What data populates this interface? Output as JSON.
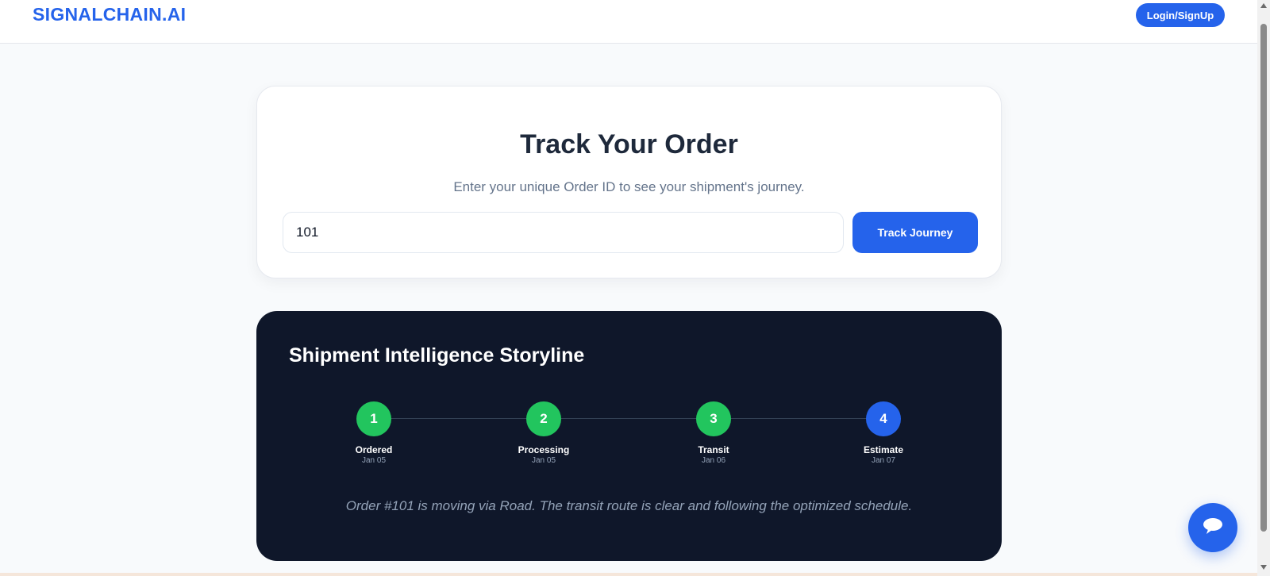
{
  "header": {
    "brand": "SIGNALCHAIN.AI",
    "login_label": "Login/SignUp"
  },
  "track": {
    "title": "Track Your Order",
    "subtitle": "Enter your unique Order ID to see your shipment's journey.",
    "order_id_value": "101",
    "button_label": "Track Journey"
  },
  "storyline": {
    "title": "Shipment Intelligence Storyline",
    "steps": [
      {
        "number": "1",
        "label": "Ordered",
        "date": "Jan 05",
        "status": "done"
      },
      {
        "number": "2",
        "label": "Processing",
        "date": "Jan 05",
        "status": "done"
      },
      {
        "number": "3",
        "label": "Transit",
        "date": "Jan 06",
        "status": "done"
      },
      {
        "number": "4",
        "label": "Estimate",
        "date": "Jan 07",
        "status": "current"
      }
    ],
    "message": "Order #101 is moving via Road. The transit route is clear and following the optimized schedule."
  },
  "chat": {
    "icon": "chat-bubble-icon"
  },
  "colors": {
    "accent": "#2563eb",
    "done": "#22c55e",
    "dark_panel": "#0f172a"
  }
}
